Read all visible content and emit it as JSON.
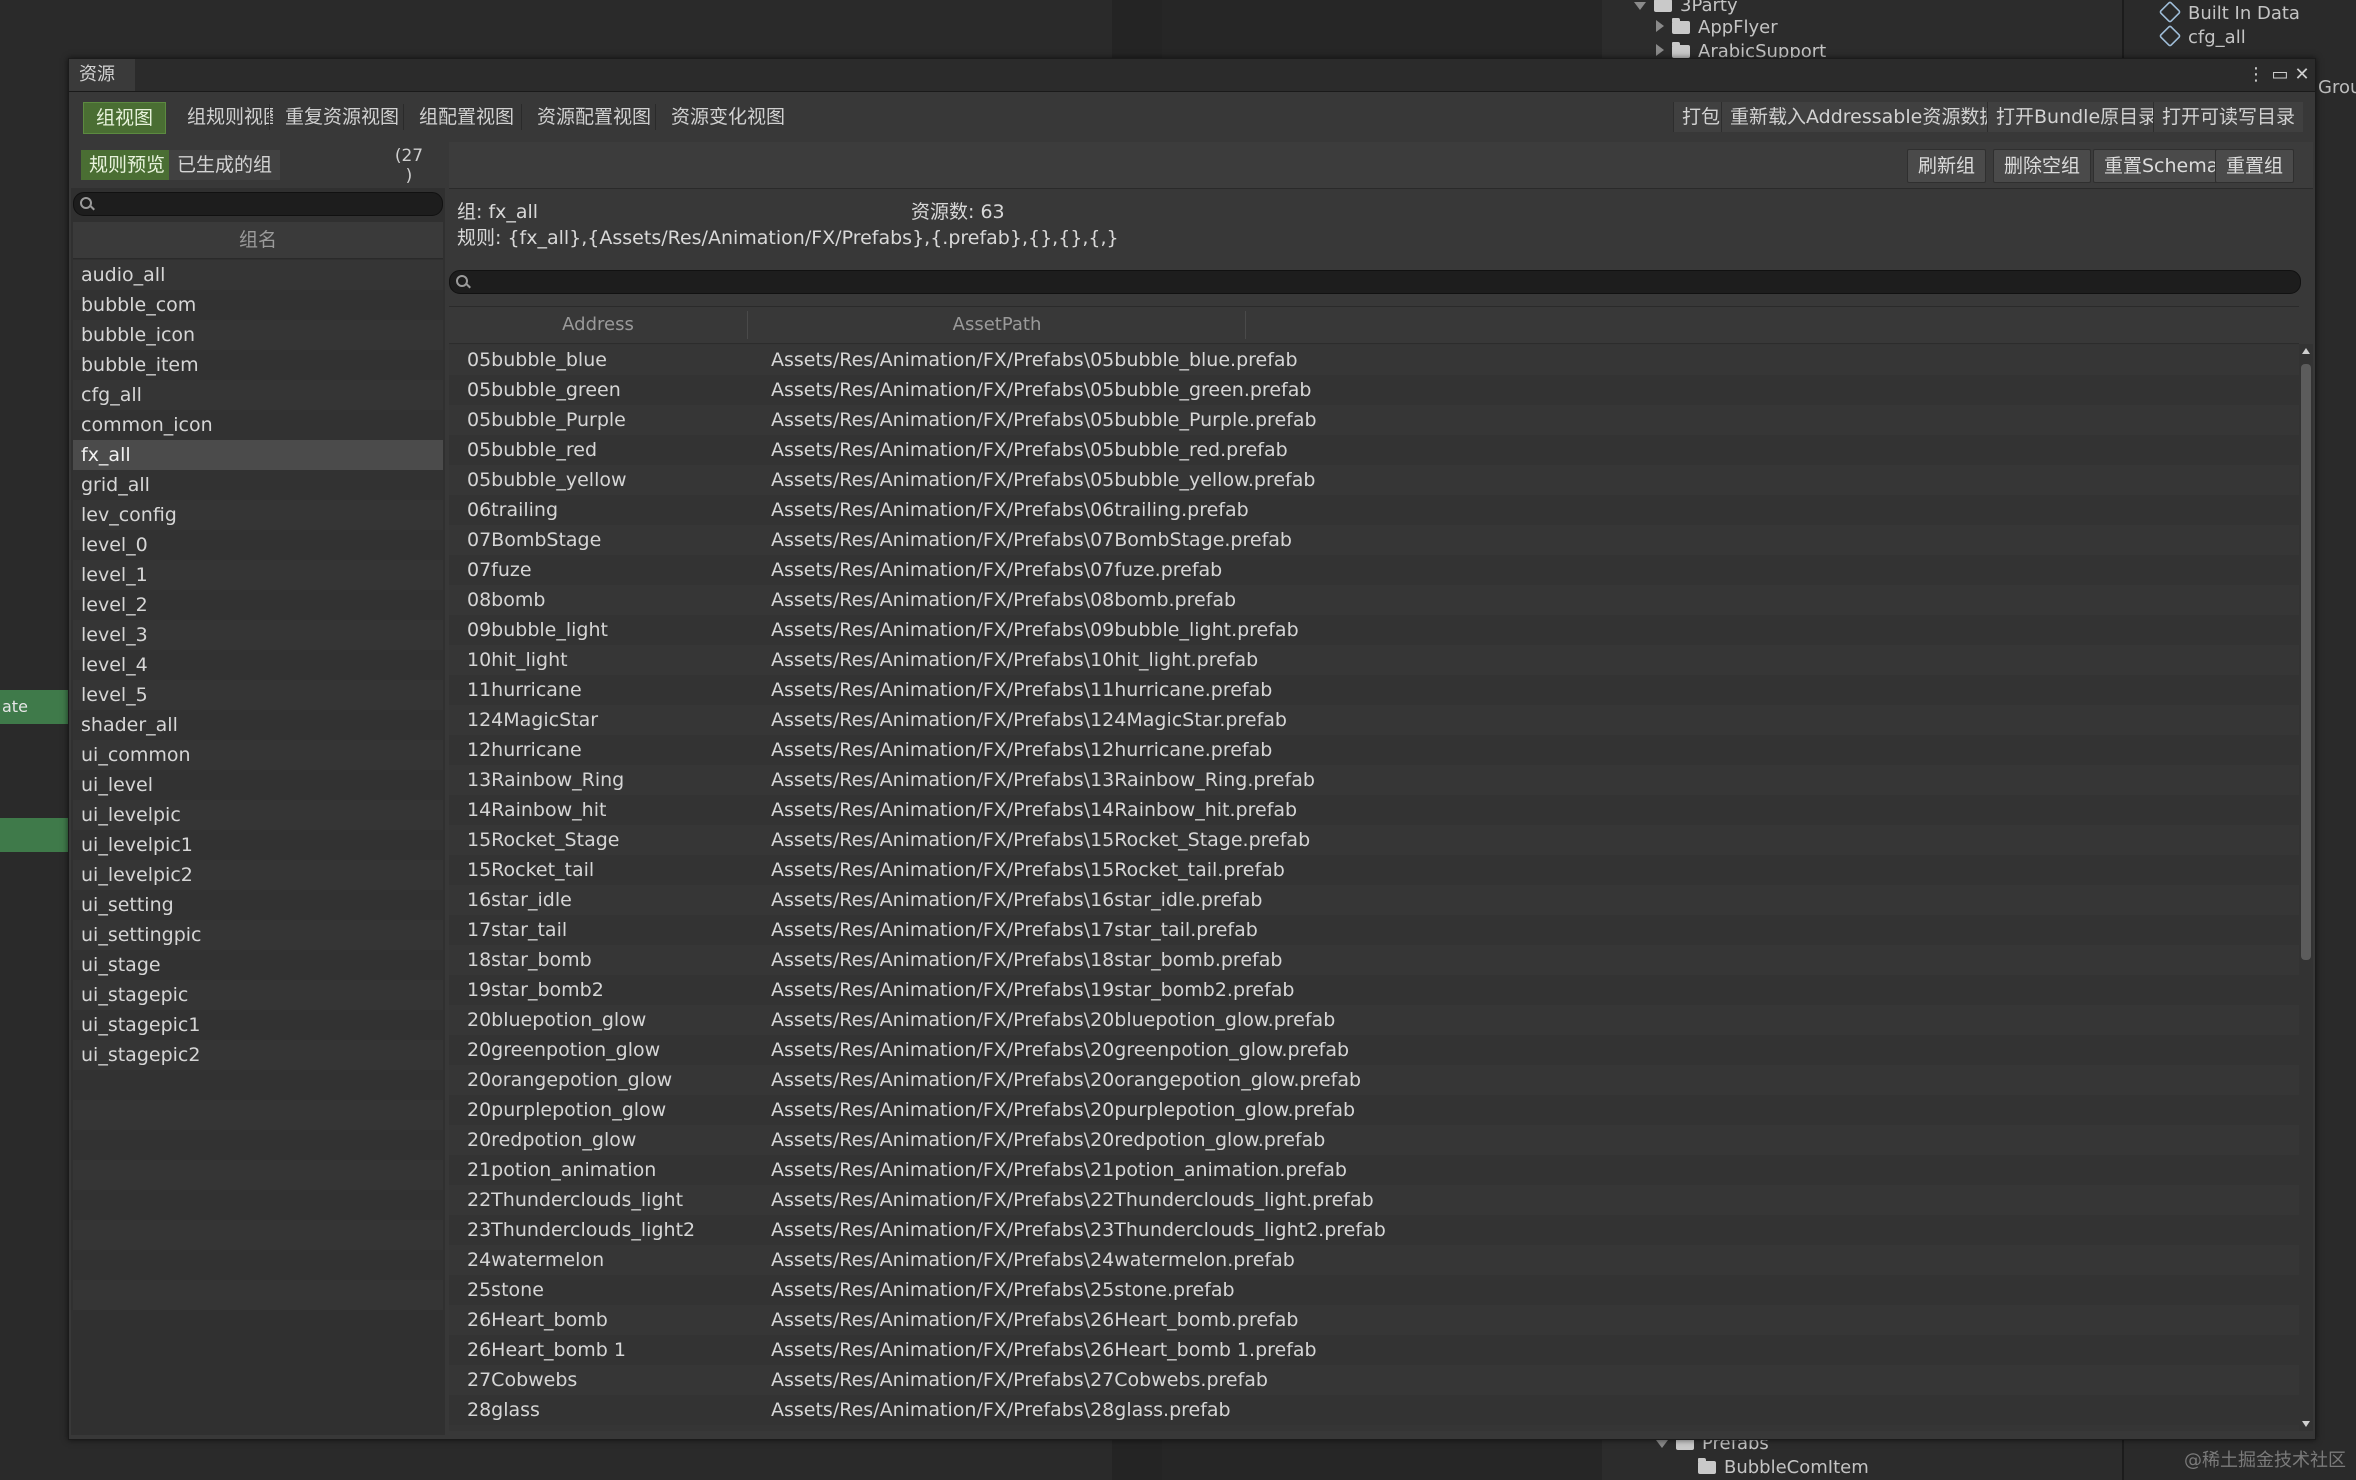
{
  "background": {
    "tree_items": [
      {
        "label": "3Party",
        "kind": "folder-open"
      },
      {
        "label": "AppFlyer",
        "kind": "folder"
      },
      {
        "label": "ArabicSupport",
        "kind": "folder"
      },
      {
        "label": "Prefabs",
        "kind": "folder-open"
      },
      {
        "label": "BubbleComItem",
        "kind": "folder"
      }
    ],
    "right_items": [
      "Built In Data",
      "cfg_all"
    ],
    "group_label": "Group",
    "left_tab_label": "ate",
    "watermark": "@稀土掘金技术社区"
  },
  "window": {
    "title": "资源",
    "tabs": [
      "组视图",
      "组规则视图",
      "重复资源视图",
      "组配置视图",
      "资源配置视图",
      "资源变化视图"
    ],
    "active_tab": 0,
    "toolbar_buttons": [
      "打包",
      "重新载入Addressable资源数据",
      "打开Bundle原目录",
      "打开可读写目录"
    ]
  },
  "left_panel": {
    "subtabs": [
      "规则预览",
      "已生成的组"
    ],
    "count": "(27\n)",
    "search_placeholder": "",
    "column_header": "组名",
    "groups": [
      "audio_all",
      "bubble_com",
      "bubble_icon",
      "bubble_item",
      "cfg_all",
      "common_icon",
      "fx_all",
      "grid_all",
      "lev_config",
      "level_0",
      "level_1",
      "level_2",
      "level_3",
      "level_4",
      "level_5",
      "shader_all",
      "ui_common",
      "ui_level",
      "ui_levelpic",
      "ui_levelpic1",
      "ui_levelpic2",
      "ui_setting",
      "ui_settingpic",
      "ui_stage",
      "ui_stagepic",
      "ui_stagepic1",
      "ui_stagepic2"
    ],
    "selected_group": "fx_all"
  },
  "right_panel": {
    "actions": [
      "刷新组",
      "删除空组",
      "重置Schema",
      "重置组"
    ],
    "group_line": "组: fx_all",
    "count_line": "资源数: 63",
    "rule_line": "规则: {fx_all},{Assets/Res/Animation/FX/Prefabs},{.prefab},{},{},{,}",
    "table": {
      "headers": [
        "Address",
        "AssetPath"
      ],
      "rows": [
        [
          "05bubble_blue",
          "Assets/Res/Animation/FX/Prefabs\\05bubble_blue.prefab"
        ],
        [
          "05bubble_green",
          "Assets/Res/Animation/FX/Prefabs\\05bubble_green.prefab"
        ],
        [
          "05bubble_Purple",
          "Assets/Res/Animation/FX/Prefabs\\05bubble_Purple.prefab"
        ],
        [
          "05bubble_red",
          "Assets/Res/Animation/FX/Prefabs\\05bubble_red.prefab"
        ],
        [
          "05bubble_yellow",
          "Assets/Res/Animation/FX/Prefabs\\05bubble_yellow.prefab"
        ],
        [
          "06trailing",
          "Assets/Res/Animation/FX/Prefabs\\06trailing.prefab"
        ],
        [
          "07BombStage",
          "Assets/Res/Animation/FX/Prefabs\\07BombStage.prefab"
        ],
        [
          "07fuze",
          "Assets/Res/Animation/FX/Prefabs\\07fuze.prefab"
        ],
        [
          "08bomb",
          "Assets/Res/Animation/FX/Prefabs\\08bomb.prefab"
        ],
        [
          "09bubble_light",
          "Assets/Res/Animation/FX/Prefabs\\09bubble_light.prefab"
        ],
        [
          "10hit_light",
          "Assets/Res/Animation/FX/Prefabs\\10hit_light.prefab"
        ],
        [
          "11hurricane",
          "Assets/Res/Animation/FX/Prefabs\\11hurricane.prefab"
        ],
        [
          "124MagicStar",
          "Assets/Res/Animation/FX/Prefabs\\124MagicStar.prefab"
        ],
        [
          "12hurricane",
          "Assets/Res/Animation/FX/Prefabs\\12hurricane.prefab"
        ],
        [
          "13Rainbow_Ring",
          "Assets/Res/Animation/FX/Prefabs\\13Rainbow_Ring.prefab"
        ],
        [
          "14Rainbow_hit",
          "Assets/Res/Animation/FX/Prefabs\\14Rainbow_hit.prefab"
        ],
        [
          "15Rocket_Stage",
          "Assets/Res/Animation/FX/Prefabs\\15Rocket_Stage.prefab"
        ],
        [
          "15Rocket_tail",
          "Assets/Res/Animation/FX/Prefabs\\15Rocket_tail.prefab"
        ],
        [
          "16star_idle",
          "Assets/Res/Animation/FX/Prefabs\\16star_idle.prefab"
        ],
        [
          "17star_tail",
          "Assets/Res/Animation/FX/Prefabs\\17star_tail.prefab"
        ],
        [
          "18star_bomb",
          "Assets/Res/Animation/FX/Prefabs\\18star_bomb.prefab"
        ],
        [
          "19star_bomb2",
          "Assets/Res/Animation/FX/Prefabs\\19star_bomb2.prefab"
        ],
        [
          "20bluepotion_glow",
          "Assets/Res/Animation/FX/Prefabs\\20bluepotion_glow.prefab"
        ],
        [
          "20greenpotion_glow",
          "Assets/Res/Animation/FX/Prefabs\\20greenpotion_glow.prefab"
        ],
        [
          "20orangepotion_glow",
          "Assets/Res/Animation/FX/Prefabs\\20orangepotion_glow.prefab"
        ],
        [
          "20purplepotion_glow",
          "Assets/Res/Animation/FX/Prefabs\\20purplepotion_glow.prefab"
        ],
        [
          "20redpotion_glow",
          "Assets/Res/Animation/FX/Prefabs\\20redpotion_glow.prefab"
        ],
        [
          "21potion_animation",
          "Assets/Res/Animation/FX/Prefabs\\21potion_animation.prefab"
        ],
        [
          "22Thunderclouds_light",
          "Assets/Res/Animation/FX/Prefabs\\22Thunderclouds_light.prefab"
        ],
        [
          "23Thunderclouds_light2",
          "Assets/Res/Animation/FX/Prefabs\\23Thunderclouds_light2.prefab"
        ],
        [
          "24watermelon",
          "Assets/Res/Animation/FX/Prefabs\\24watermelon.prefab"
        ],
        [
          "25stone",
          "Assets/Res/Animation/FX/Prefabs\\25stone.prefab"
        ],
        [
          "26Heart_bomb",
          "Assets/Res/Animation/FX/Prefabs\\26Heart_bomb.prefab"
        ],
        [
          "26Heart_bomb 1",
          "Assets/Res/Animation/FX/Prefabs\\26Heart_bomb 1.prefab"
        ],
        [
          "27Cobwebs",
          "Assets/Res/Animation/FX/Prefabs\\27Cobwebs.prefab"
        ],
        [
          "28glass",
          "Assets/Res/Animation/FX/Prefabs\\28glass.prefab"
        ]
      ]
    }
  },
  "colors": {
    "accent_green": "#4a6e33",
    "bg": "#383838"
  }
}
